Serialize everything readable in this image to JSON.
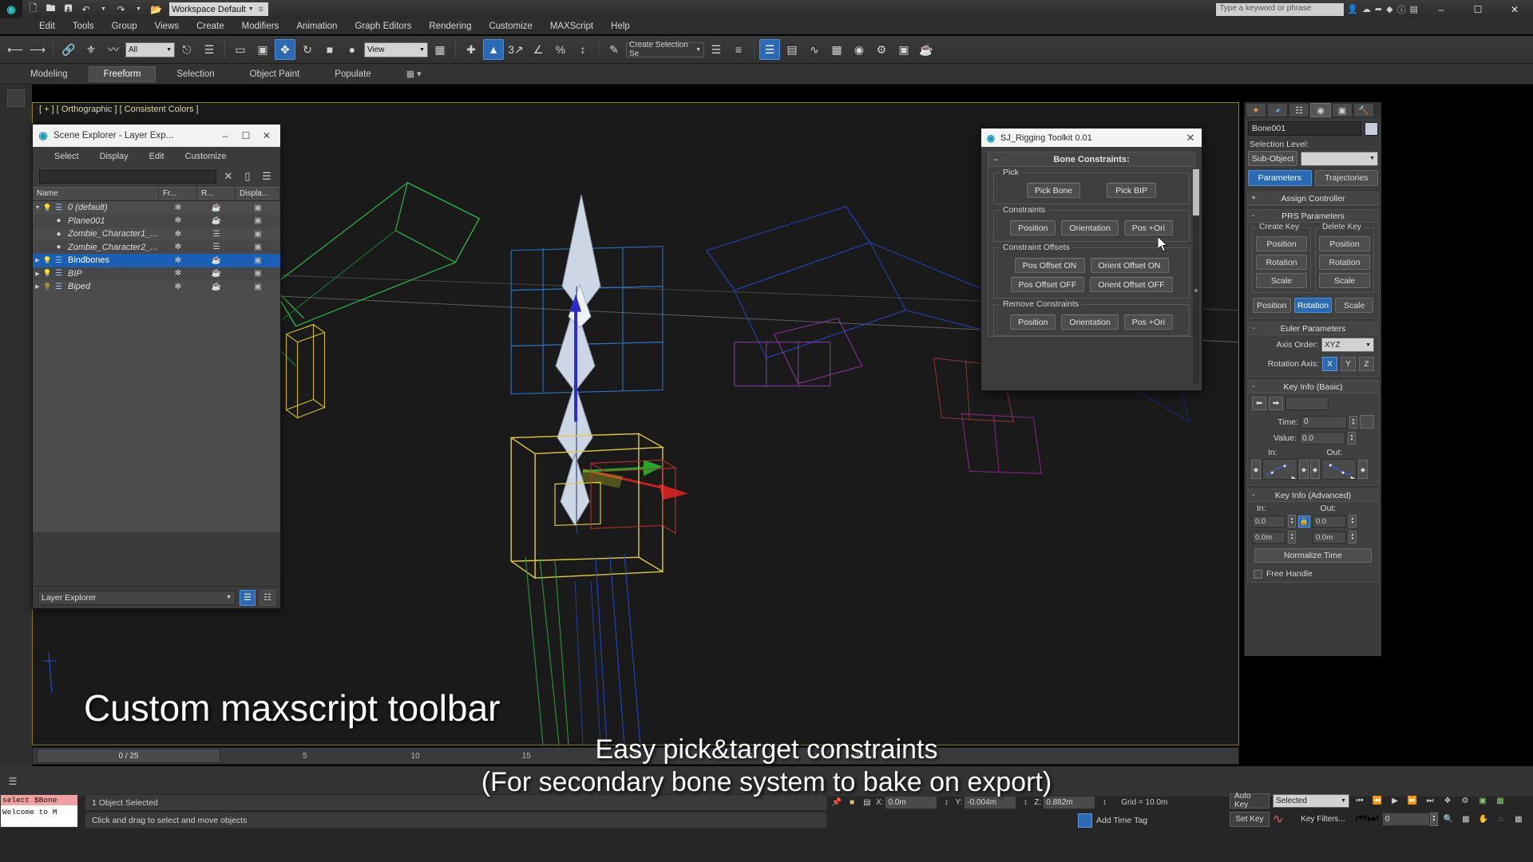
{
  "titlebar": {
    "app_icon": "max-logo-icon",
    "workspace": "Workspace Default",
    "quick_access": [
      "new-icon",
      "open-icon",
      "save-icon",
      "undo-icon",
      "redo-icon",
      "set-project-icon"
    ],
    "search_placeholder": "Type a keyword or phrase",
    "window_buttons": [
      "minimize",
      "maximize",
      "close"
    ]
  },
  "menubar": {
    "items": [
      "Edit",
      "Tools",
      "Group",
      "Views",
      "Create",
      "Modifiers",
      "Animation",
      "Graph Editors",
      "Rendering",
      "Customize",
      "MAXScript",
      "Help"
    ]
  },
  "maintoolbar": {
    "selection_filter": "All",
    "ref_coord": "View",
    "selection_set": "Create Selection Se"
  },
  "ribbon": {
    "tabs": [
      "Modeling",
      "Freeform",
      "Selection",
      "Object Paint",
      "Populate"
    ],
    "active": "Freeform"
  },
  "viewport": {
    "label": "[ + ] [ Orthographic ] [ Consistent Colors ]"
  },
  "scene_explorer": {
    "title": "Scene Explorer - Layer Exp...",
    "menu": [
      "Select",
      "Display",
      "Edit",
      "Customize"
    ],
    "search_value": "",
    "columns": [
      "Name",
      "Fr...",
      "R...",
      "Displa..."
    ],
    "footer_selector": "Layer Explorer",
    "rows": [
      {
        "name": "0 (default)",
        "indent": 0,
        "expander": "down",
        "bulb": true,
        "selected": false
      },
      {
        "name": "Plane001",
        "indent": 1,
        "expander": "none",
        "bulb": false,
        "selected": false
      },
      {
        "name": "Zombie_Character1_...",
        "indent": 1,
        "expander": "none",
        "bulb": false,
        "selected": false
      },
      {
        "name": "Zombie_Character2_...",
        "indent": 1,
        "expander": "none",
        "bulb": false,
        "selected": false
      },
      {
        "name": "Bindbones",
        "indent": 0,
        "expander": "right",
        "bulb": true,
        "selected": true
      },
      {
        "name": "BIP",
        "indent": 0,
        "expander": "right",
        "bulb": true,
        "selected": false
      },
      {
        "name": "Biped",
        "indent": 0,
        "expander": "right",
        "bulb": false,
        "selected": false
      }
    ]
  },
  "rigging_toolkit": {
    "title": "SJ_Rigging Toolkit 0.01",
    "rollout_title": "Bone Constraints:",
    "groups": [
      {
        "label": "Pick",
        "buttons": [
          "Pick Bone",
          "Pick BIP"
        ]
      },
      {
        "label": "Constraints",
        "buttons": [
          "Position",
          "Orientation",
          "Pos +Ori"
        ]
      },
      {
        "label": "Constraint Offsets",
        "buttons_row1": [
          "Pos Offset ON",
          "Orient Offset ON"
        ],
        "buttons_row2": [
          "Pos Offset OFF",
          "Orient Offset OFF"
        ]
      },
      {
        "label": "Remove Constraints",
        "buttons": [
          "Position",
          "Orientation",
          "Pos +Ori"
        ]
      }
    ]
  },
  "command_panel": {
    "tabs": [
      "create-icon",
      "modify-icon",
      "hierarchy-icon",
      "motion-icon",
      "display-icon",
      "utilities-icon"
    ],
    "active_tab_index": 3,
    "object_name": "Bone001",
    "selection_level_label": "Selection Level:",
    "sub_object_button": "Sub-Object",
    "sub_object_value": "",
    "mode_tabs": [
      "Parameters",
      "Trajectories"
    ],
    "mode_active": "Parameters",
    "assign_controller": {
      "state": "+",
      "title": "Assign Controller"
    },
    "prs": {
      "state": "-",
      "title": "PRS Parameters",
      "create_key_label": "Create Key",
      "delete_key_label": "Delete Key",
      "create_keys": [
        "Position",
        "Rotation",
        "Scale"
      ],
      "delete_keys": [
        "Position",
        "Rotation",
        "Scale"
      ],
      "prs_row": [
        "Position",
        "Rotation",
        "Scale"
      ],
      "prs_active": "Rotation"
    },
    "euler": {
      "state": "-",
      "title": "Euler Parameters",
      "axis_order_label": "Axis Order:",
      "axis_order_value": "XYZ",
      "rotation_axis_label": "Rotation Axis:",
      "rotation_axes": [
        "X",
        "Y",
        "Z"
      ],
      "rotation_axis_active": "X"
    },
    "key_info_basic": {
      "state": "-",
      "title": "Key Info (Basic)",
      "key_number": "",
      "time_label": "Time:",
      "time_value": "0",
      "value_label": "Value:",
      "value_value": "0.0",
      "in_label": "In:",
      "out_label": "Out:"
    },
    "key_info_advanced": {
      "state": "-",
      "title": "Key Info (Advanced)",
      "in_label": "In:",
      "out_label": "Out:",
      "in_value_top": "0.0",
      "out_value_top": "0.0",
      "in_value_bottom": "0.0m",
      "out_value_bottom": "0.0m",
      "normalize_time": "Normalize Time",
      "free_handle": "Free Handle",
      "free_handle_checked": false
    }
  },
  "timeline": {
    "range_label": "0 / 25"
  },
  "status": {
    "listener_line1": "select $Bone",
    "listener_line2": "Welcome to M",
    "selection_status": "1 Object Selected",
    "prompt": "Click and drag to select and move objects",
    "coords": [
      {
        "axis": "X:",
        "value": "0.0m"
      },
      {
        "axis": "Y:",
        "value": "-0.004m"
      },
      {
        "axis": "Z:",
        "value": "0.882m"
      }
    ],
    "grid": "Grid = 10.0m",
    "add_time_tag": "Add Time Tag",
    "auto_key": "Auto Key",
    "set_key": "Set Key",
    "key_mode_value": "Selected",
    "key_filters": "Key Filters...",
    "frame_value": "0"
  },
  "caption": {
    "line1": "Custom maxscript toolbar",
    "line2": "Easy pick&target constraints",
    "line3": "(For secondary bone system to bake on export)"
  },
  "colors": {
    "accent_blue": "#2a6ab5",
    "select_blue": "#1a5fb4",
    "panel_bg": "#3b3b3b",
    "viewport_bg": "#1a1a1a",
    "viewport_border": "#8a7a2a"
  }
}
